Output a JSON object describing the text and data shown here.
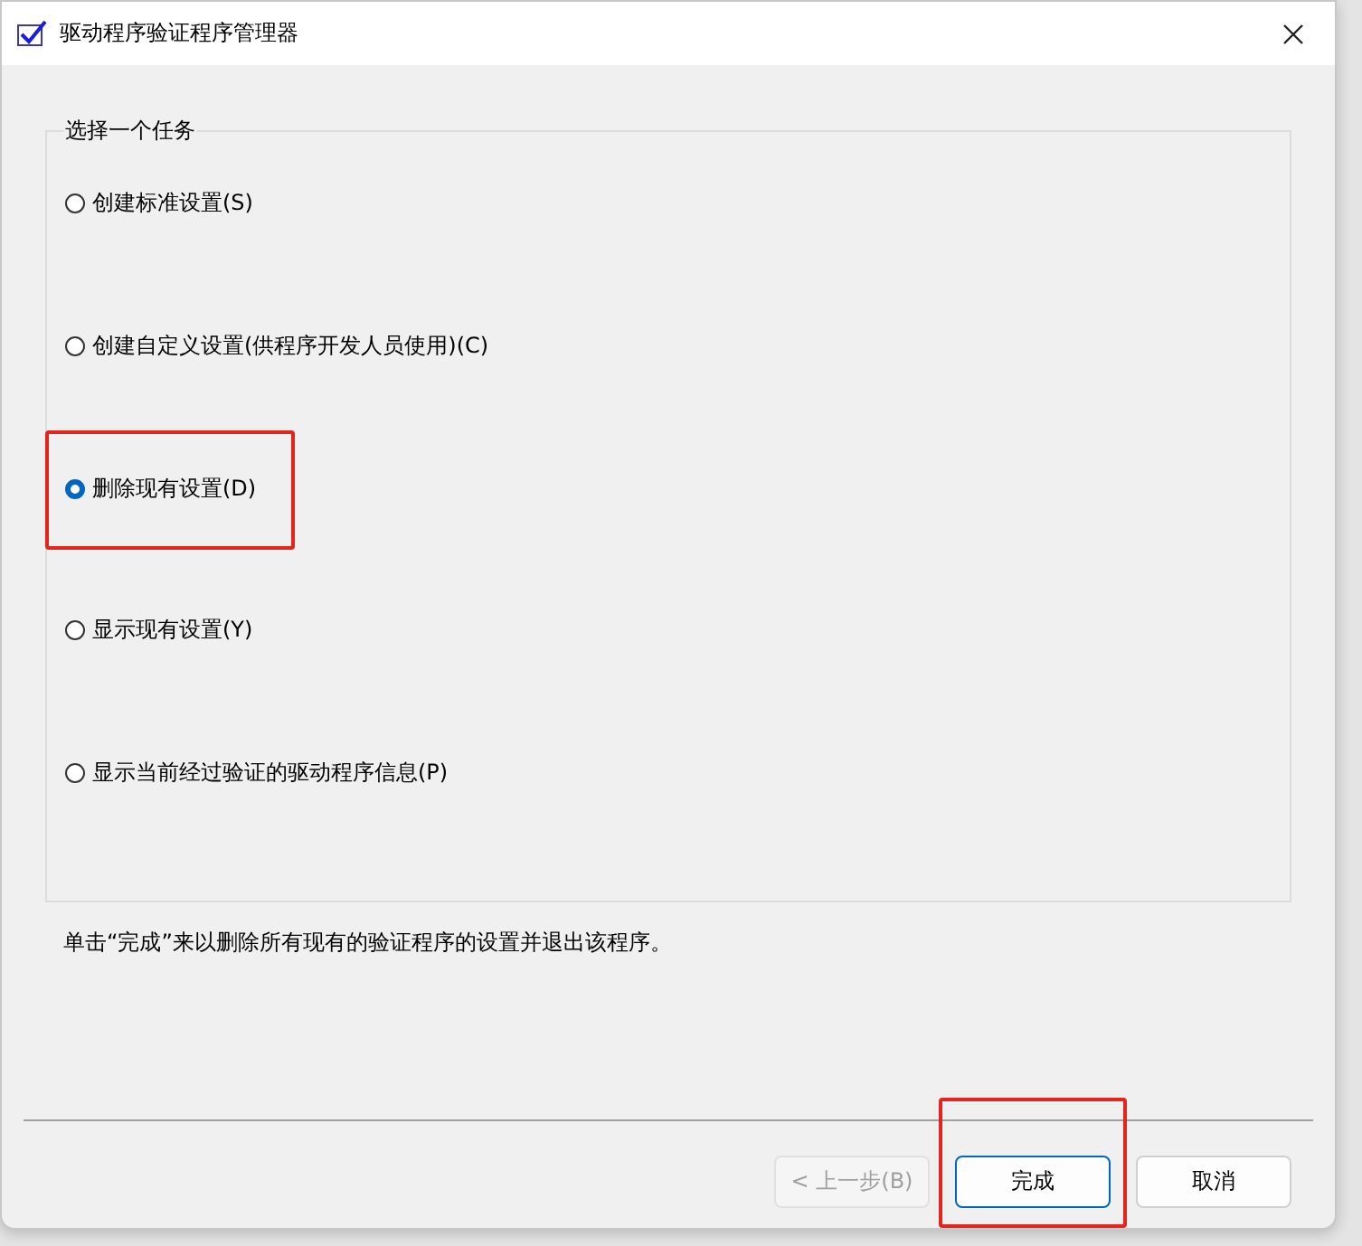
{
  "window": {
    "title": "驱动程序验证程序管理器"
  },
  "group": {
    "legend": "选择一个任务",
    "options": [
      {
        "label": "创建标准设置(S)",
        "selected": false,
        "highlighted": false
      },
      {
        "label": "创建自定义设置(供程序开发人员使用)(C)",
        "selected": false,
        "highlighted": false
      },
      {
        "label": "删除现有设置(D)",
        "selected": true,
        "highlighted": true
      },
      {
        "label": "显示现有设置(Y)",
        "selected": false,
        "highlighted": false
      },
      {
        "label": "显示当前经过验证的驱动程序信息(P)",
        "selected": false,
        "highlighted": false
      }
    ]
  },
  "description": "单击“完成”来以删除所有现有的验证程序的设置并退出该程序。",
  "buttons": [
    {
      "label": "< 上一步(B)",
      "disabled": true,
      "default": false,
      "highlighted": false
    },
    {
      "label": "完成",
      "disabled": false,
      "default": true,
      "highlighted": true
    },
    {
      "label": "取消",
      "disabled": false,
      "default": false,
      "highlighted": false
    }
  ]
}
